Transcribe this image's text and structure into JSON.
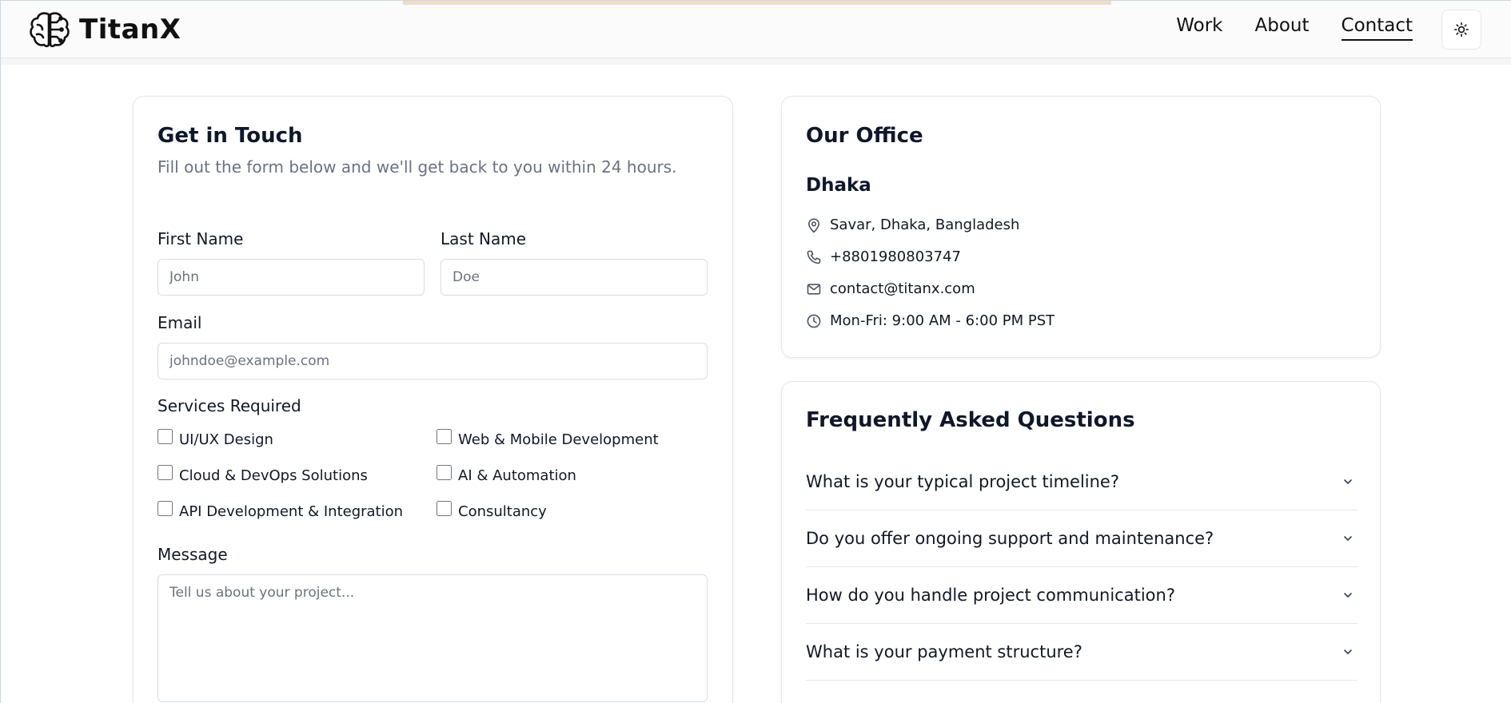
{
  "header": {
    "brand": "TitanX",
    "nav": [
      {
        "label": "Work"
      },
      {
        "label": "About"
      },
      {
        "label": "Contact"
      }
    ]
  },
  "form": {
    "title": "Get in Touch",
    "subtitle": "Fill out the form below and we'll get back to you within 24 hours.",
    "first_name": {
      "label": "First Name",
      "placeholder": "John"
    },
    "last_name": {
      "label": "Last Name",
      "placeholder": "Doe"
    },
    "email": {
      "label": "Email",
      "placeholder": "johndoe@example.com"
    },
    "services": {
      "label": "Services Required",
      "options": [
        {
          "label": "UI/UX Design"
        },
        {
          "label": "Web & Mobile Development"
        },
        {
          "label": "Cloud & DevOps Solutions"
        },
        {
          "label": "AI & Automation"
        },
        {
          "label": "API Development & Integration"
        },
        {
          "label": "Consultancy"
        }
      ]
    },
    "message": {
      "label": "Message",
      "placeholder": "Tell us about your project..."
    }
  },
  "office": {
    "title": "Our Office",
    "city": "Dhaka",
    "address": "Savar, Dhaka, Bangladesh",
    "phone": "+8801980803747",
    "email": "contact@titanx.com",
    "hours": "Mon-Fri: 9:00 AM - 6:00 PM PST"
  },
  "faq": {
    "title": "Frequently Asked Questions",
    "items": [
      {
        "question": "What is your typical project timeline?"
      },
      {
        "question": "Do you offer ongoing support and maintenance?"
      },
      {
        "question": "How do you handle project communication?"
      },
      {
        "question": "What is your payment structure?"
      }
    ]
  },
  "icons": {
    "logo": "brain-logo-icon",
    "theme_toggle": "sun-icon",
    "address": "map-pin-icon",
    "phone": "phone-icon",
    "email": "mail-icon",
    "hours": "clock-icon",
    "faq_toggle": "chevron-down-icon"
  }
}
